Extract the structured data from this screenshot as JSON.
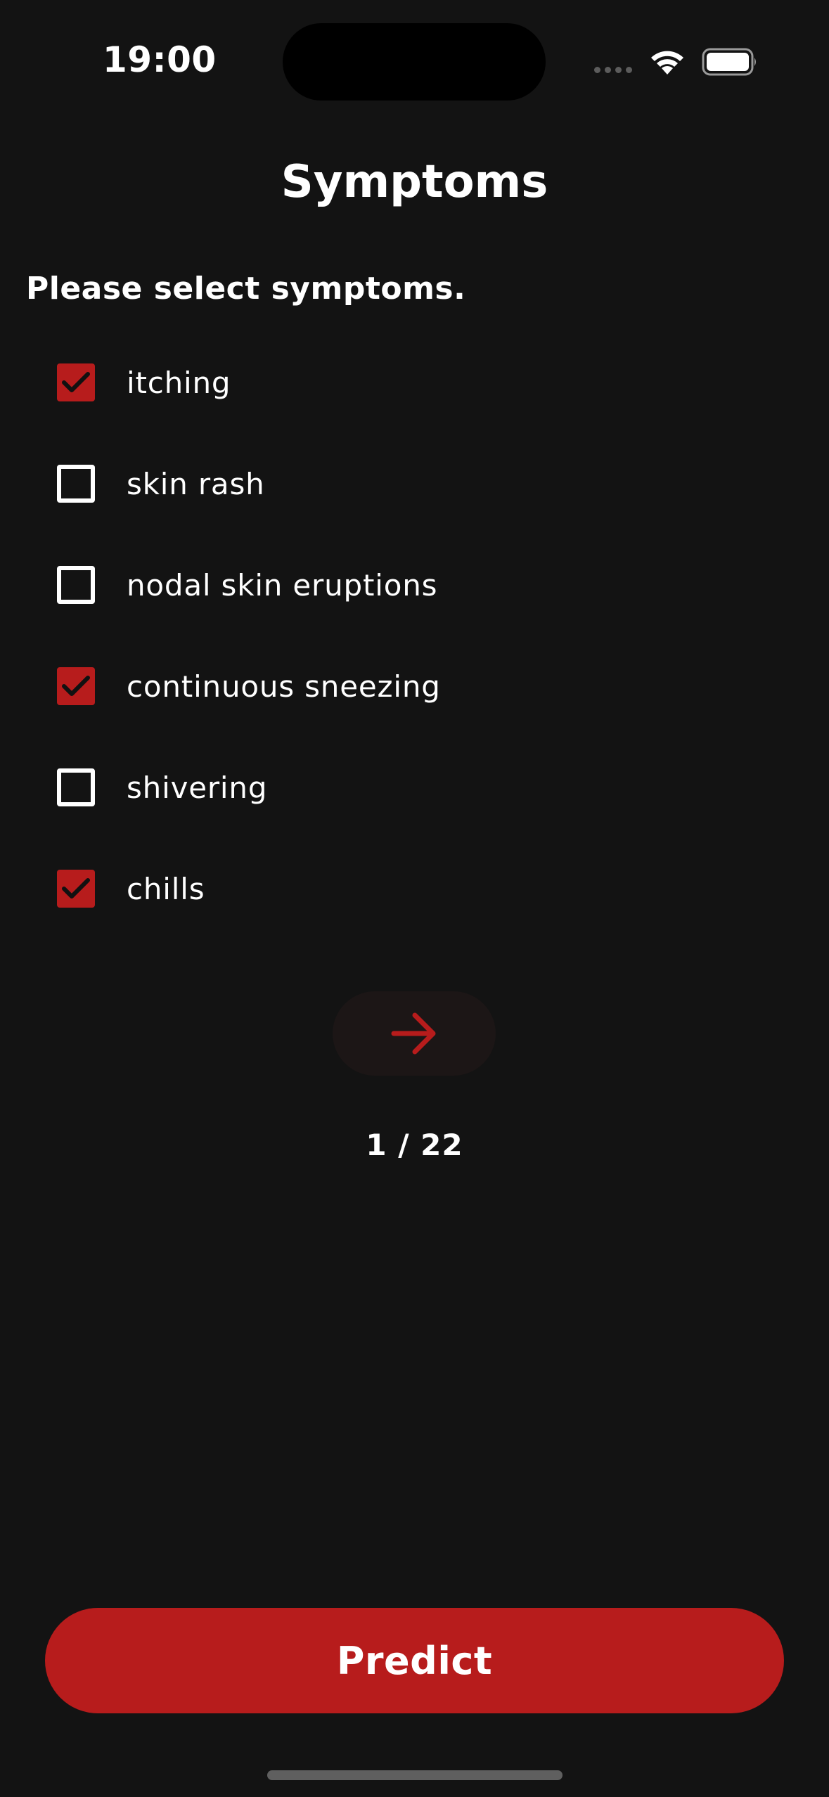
{
  "status_bar": {
    "time": "19:00"
  },
  "header": {
    "title": "Symptoms"
  },
  "instruction": "Please select symptoms.",
  "symptoms": [
    {
      "label": "itching",
      "checked": true
    },
    {
      "label": "skin rash",
      "checked": false
    },
    {
      "label": "nodal skin eruptions",
      "checked": false
    },
    {
      "label": "continuous sneezing",
      "checked": true
    },
    {
      "label": "shivering",
      "checked": false
    },
    {
      "label": "chills",
      "checked": true
    }
  ],
  "pager": {
    "indicator": "1 / 22",
    "next_icon": "arrow-right-icon"
  },
  "actions": {
    "predict_label": "Predict"
  },
  "colors": {
    "background": "#131313",
    "accent": "#b71c1c",
    "text": "#ffffff"
  }
}
